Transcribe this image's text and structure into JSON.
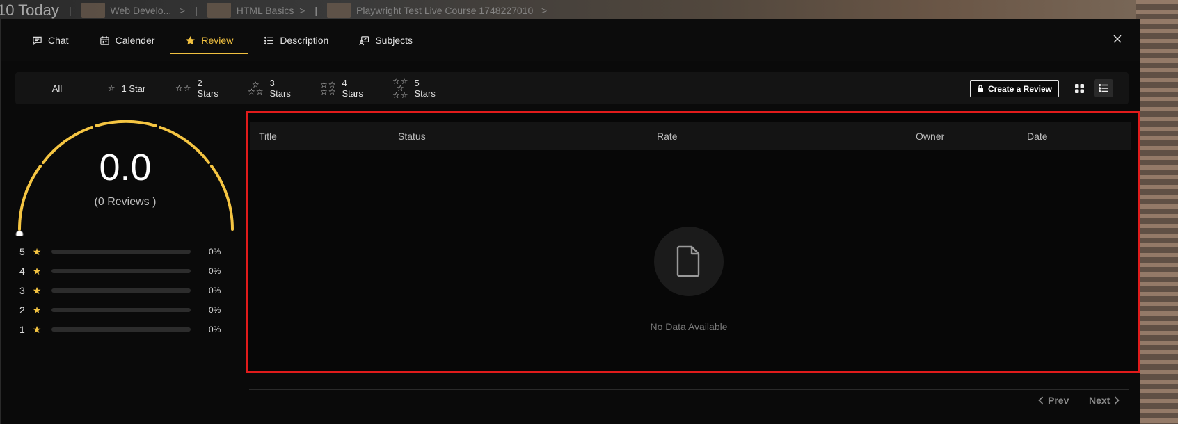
{
  "background": {
    "today_label": "10 Today",
    "crumbs": [
      "Web Develo...",
      "HTML Basics",
      "Playwright Test Live Course 1748227010"
    ]
  },
  "tabs": [
    {
      "label": "Chat",
      "icon": "chat-icon"
    },
    {
      "label": "Calender",
      "icon": "calendar-icon"
    },
    {
      "label": "Review",
      "icon": "star-icon",
      "active": true
    },
    {
      "label": "Description",
      "icon": "list-icon"
    },
    {
      "label": "Subjects",
      "icon": "subjects-icon"
    }
  ],
  "filters": {
    "all": "All",
    "one": "1 Star",
    "two": "2 Stars",
    "three": "3 Stars",
    "four": "4 Stars",
    "five": "5 Stars",
    "create_label": "Create a Review"
  },
  "summary": {
    "score": "0.0",
    "reviews_label": "(0 Reviews )",
    "distribution": [
      {
        "stars": "5",
        "percent": "0%",
        "fraction": 0
      },
      {
        "stars": "4",
        "percent": "0%",
        "fraction": 0
      },
      {
        "stars": "3",
        "percent": "0%",
        "fraction": 0
      },
      {
        "stars": "2",
        "percent": "0%",
        "fraction": 0
      },
      {
        "stars": "1",
        "percent": "0%",
        "fraction": 0
      }
    ]
  },
  "table": {
    "columns": [
      "Title",
      "Status",
      "Rate",
      "Owner",
      "Date"
    ],
    "empty_text": "No Data Available"
  },
  "pager": {
    "prev": "Prev",
    "next": "Next"
  },
  "colors": {
    "accent": "#f0c040",
    "highlight_border": "#e01b1b"
  }
}
